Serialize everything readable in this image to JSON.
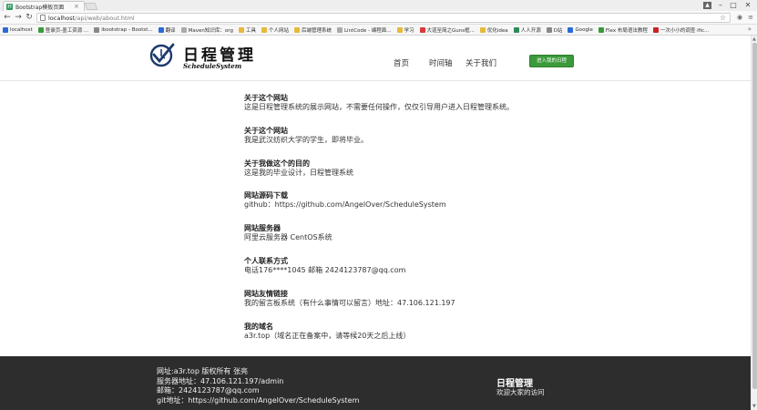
{
  "browser": {
    "tab_title": "Bootstrap模板页面",
    "tab_favicon": "H",
    "url_host": "localhost",
    "url_path": "/api/web/about.html",
    "bookmarks": [
      {
        "label": "localhost",
        "icon": "grid-app-icon",
        "color": "#2a6ad8"
      },
      {
        "label": "登录页-墨工资源 ...",
        "icon": "z-app-icon",
        "color": "#3a9a3a"
      },
      {
        "label": "ibootstrap - Bootst...",
        "icon": "bootstrap-icon",
        "color": "#888888"
      },
      {
        "label": "翻译",
        "icon": "translate-icon",
        "color": "#2a6ad8"
      },
      {
        "label": "Maven知识库：org",
        "icon": "page-icon",
        "color": "#aaaaaa"
      },
      {
        "label": "工具",
        "icon": "folder-icon",
        "color": "#e6b93a"
      },
      {
        "label": "个人网站",
        "icon": "folder-icon",
        "color": "#e6b93a"
      },
      {
        "label": "后端管理系统",
        "icon": "folder-icon",
        "color": "#e6b93a"
      },
      {
        "label": "LintCode - 编程面...",
        "icon": "page-icon",
        "color": "#aaaaaa"
      },
      {
        "label": "学习",
        "icon": "folder-icon",
        "color": "#e6b93a"
      },
      {
        "label": "大道至简之Guns框...",
        "icon": "bolt-icon",
        "color": "#d93a3a"
      },
      {
        "label": "优化idea",
        "icon": "folder-icon",
        "color": "#e6b93a"
      },
      {
        "label": "人人开源",
        "icon": "a-app-icon",
        "color": "#2f8a5a"
      },
      {
        "label": "D站",
        "icon": "gear-small-icon",
        "color": "#888888"
      },
      {
        "label": "Google",
        "icon": "google-icon",
        "color": "#2a6ad8"
      },
      {
        "label": "Flex 布局语法教程",
        "icon": "leaf-icon",
        "color": "#3a9a3a"
      },
      {
        "label": "一次小小的调查 ific...",
        "icon": "c-app-icon",
        "color": "#cc2222"
      }
    ]
  },
  "header": {
    "brand_title": "日程管理",
    "brand_subtitle": "ScheduleSystem",
    "nav": {
      "home": "首页",
      "timeline": "时间轴",
      "about": "关于我们"
    },
    "cta_label": "进入我的日程"
  },
  "sections": [
    {
      "title": "关于这个网站",
      "text": "这是日程管理系统的展示网站，不需要任何操作，仅仅引导用户进入日程管理系统。"
    },
    {
      "title": "关于这个网站",
      "text": "我是武汉纺织大学的学生，即将毕业。"
    },
    {
      "title": "关于我做这个的目的",
      "text": "这是我的毕业设计，日程管理系统"
    },
    {
      "title": "网站源码下载",
      "text": "github：https://github.com/AngelOver/ScheduleSystem"
    },
    {
      "title": "网站服务器",
      "text": "阿里云服务器 CentOS系统"
    },
    {
      "title": "个人联系方式",
      "text": "电话176****1045 邮箱 2424123787@qq.com"
    },
    {
      "title": "网站友情链接",
      "text": "我的留言板系统（有什么事情可以留言）地址：47.106.121.197"
    },
    {
      "title": "我的域名",
      "text": "a3r.top（域名正在备案中，请等候20天之后上线）"
    }
  ],
  "footer": {
    "lines": [
      "网址:a3r.top 版权所有 张亮",
      "服务器地址：47.106.121.197/admin",
      "邮箱：2424123787@qq.com",
      "git地址：https://github.com/AngelOver/ScheduleSystem"
    ],
    "brand": "日程管理",
    "welcome": "欢迎大家的访问"
  },
  "colors": {
    "cta": "#3a9a3a",
    "footer_bg": "#2d2d2d"
  }
}
